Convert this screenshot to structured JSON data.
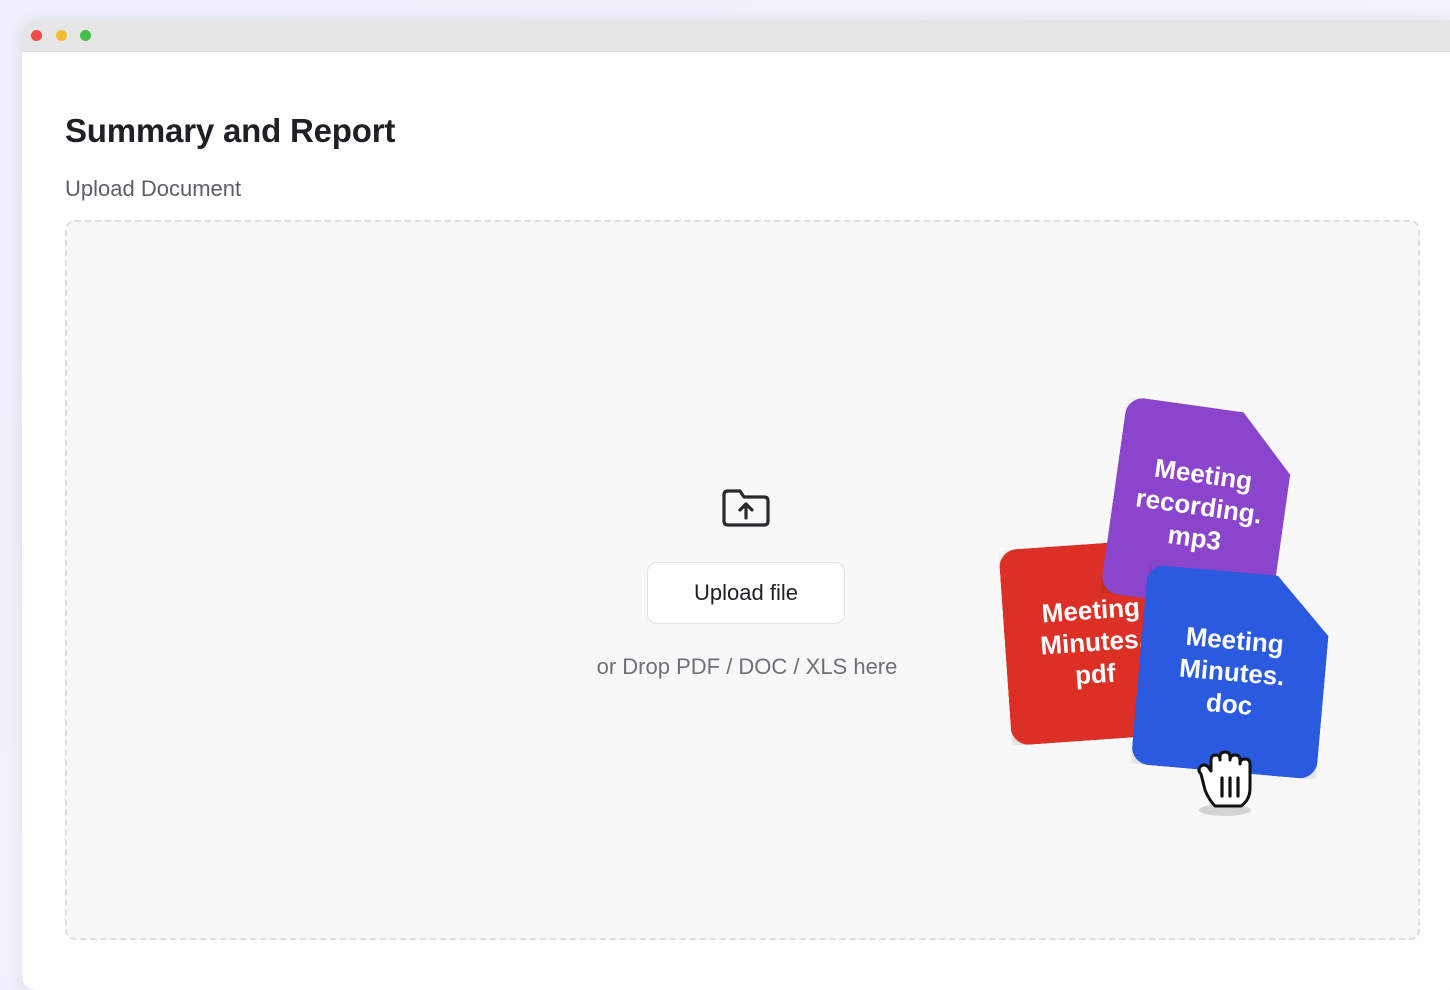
{
  "page": {
    "title": "Summary and Report",
    "section_label": "Upload Document"
  },
  "upload": {
    "icon": "folder-upload-icon",
    "button_label": "Upload file",
    "drop_hint": "or Drop PDF / DOC / XLS here"
  },
  "illustration": {
    "files": [
      {
        "label": "Meeting\nMinutes.\npdf",
        "color": "#dc3026"
      },
      {
        "label": "Meeting\nrecording.\nmp3",
        "color": "#8a45cc"
      },
      {
        "label": "Meeting\nMinutes.\ndoc",
        "color": "#2a5ae0"
      }
    ],
    "cursor_icon": "grab-hand-cursor-icon"
  },
  "window": {
    "traffic_lights": [
      "#ef4a43",
      "#f5bd33",
      "#3fc14a"
    ]
  }
}
